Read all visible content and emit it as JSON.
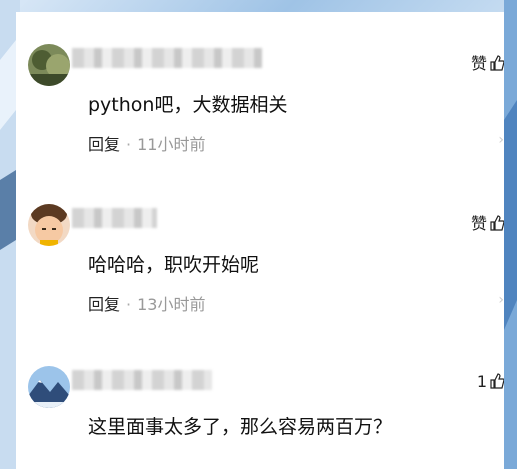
{
  "comments": [
    {
      "username": "",
      "text": "python吧，大数据相关",
      "reply_label": "回复",
      "time": "11小时前",
      "like_label": "赞",
      "avatar": "landscape-avatar"
    },
    {
      "username": "",
      "text": "哈哈哈，职吹开始呢",
      "reply_label": "回复",
      "time": "13小时前",
      "like_label": "赞",
      "avatar": "child-avatar"
    },
    {
      "username": "",
      "text": "这里面事太多了，那么容易两百万？",
      "reply_label": "",
      "time": "",
      "like_label": "1",
      "avatar": "mountain-avatar"
    }
  ],
  "icons": {
    "thumb": "thumb-up-icon",
    "chevron": "chevron-right-icon"
  },
  "colors": {
    "time": "#999999",
    "background_blue": "#9fc3e6"
  }
}
